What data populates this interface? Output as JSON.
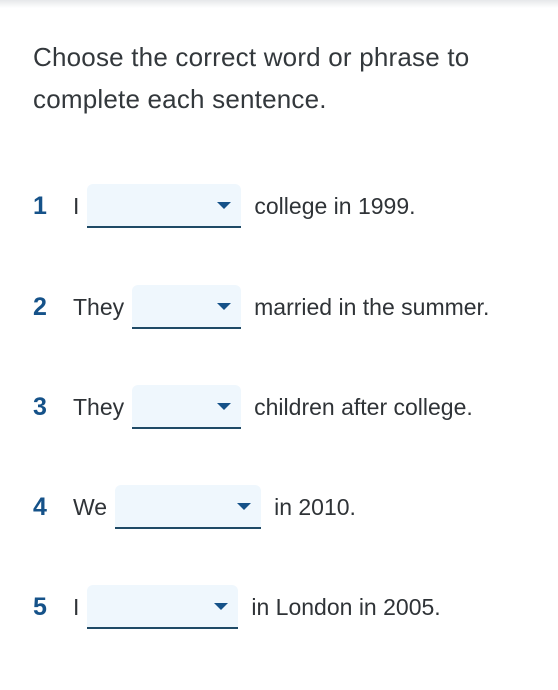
{
  "instructions": "Choose the correct word or phrase to complete each sentence.",
  "questions": [
    {
      "number": "1",
      "before": "I",
      "after": "college in 1999.",
      "selected": ""
    },
    {
      "number": "2",
      "before": "They",
      "after": "married in the summer.",
      "selected": ""
    },
    {
      "number": "3",
      "before": "They",
      "after": "children after college.",
      "selected": ""
    },
    {
      "number": "4",
      "before": "We",
      "after": "in 2010.",
      "selected": ""
    },
    {
      "number": "5",
      "before": "I",
      "after": "in London in 2005.",
      "selected": ""
    }
  ],
  "colors": {
    "accent": "#155289",
    "dropdown_bg": "#eff7fd",
    "text": "#2f3337"
  }
}
